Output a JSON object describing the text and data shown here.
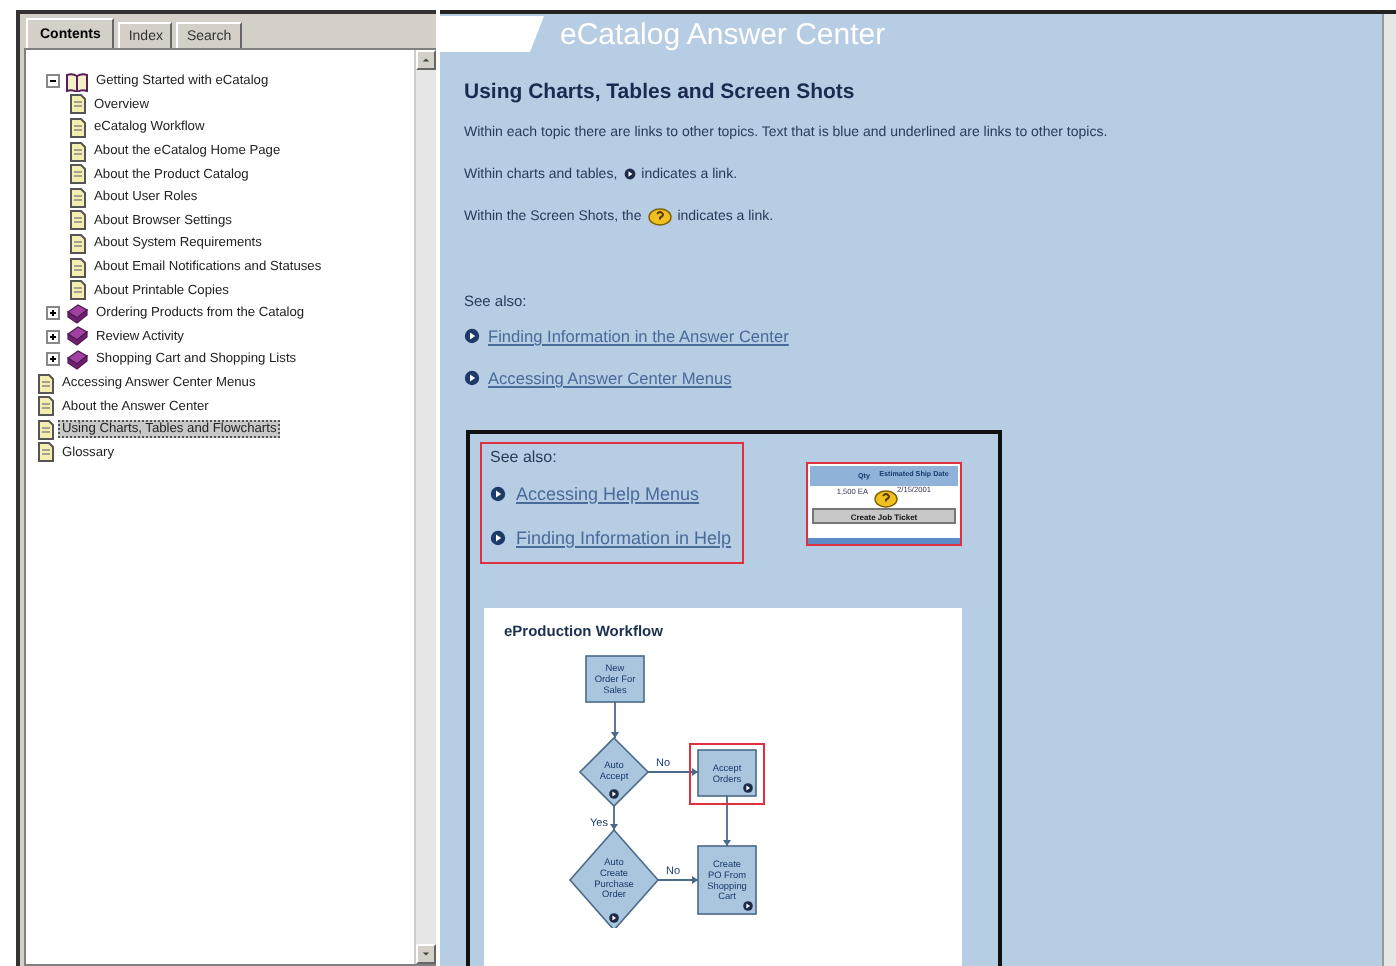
{
  "tabs": [
    {
      "label": "Contents",
      "selected": true
    },
    {
      "label": "Index",
      "selected": false
    },
    {
      "label": "Search",
      "selected": false
    }
  ],
  "tree": [
    {
      "label": "Getting Started with eCatalog",
      "kind": "book",
      "expanded": true,
      "selected": false,
      "children": [
        {
          "label": "Overview",
          "kind": "page",
          "selected": false
        },
        {
          "label": "eCatalog Workflow",
          "kind": "page",
          "selected": false
        },
        {
          "label": "About the eCatalog Home Page",
          "kind": "page",
          "selected": false
        },
        {
          "label": "About the Product Catalog",
          "kind": "page",
          "selected": false
        },
        {
          "label": "About User Roles",
          "kind": "page",
          "selected": false
        },
        {
          "label": "About Browser Settings",
          "kind": "page",
          "selected": false
        },
        {
          "label": "About System Requirements",
          "kind": "page",
          "selected": false
        },
        {
          "label": "About Email Notifications and Statuses",
          "kind": "page",
          "selected": false
        },
        {
          "label": "About Printable Copies",
          "kind": "page",
          "selected": false
        }
      ]
    },
    {
      "label": "Ordering Products from the Catalog",
      "kind": "book",
      "expanded": false,
      "selected": false
    },
    {
      "label": "Review Activity",
      "kind": "book",
      "expanded": false,
      "selected": false
    },
    {
      "label": "Shopping Cart and Shopping Lists",
      "kind": "book",
      "expanded": false,
      "selected": false
    },
    {
      "label": "Accessing Answer Center Menus",
      "kind": "page",
      "selected": false
    },
    {
      "label": "About the Answer Center",
      "kind": "page",
      "selected": false
    },
    {
      "label": "Using Charts, Tables and Flowcharts",
      "kind": "page",
      "selected": true
    },
    {
      "label": "Glossary",
      "kind": "page",
      "selected": false
    }
  ],
  "header": {
    "title": "eCatalog Answer Center"
  },
  "topic": {
    "heading": "Using Charts, Tables and Screen Shots",
    "paragraphs": [
      {
        "parts": [
          {
            "kind": "text",
            "text": "Within each topic there are links to other topics. Text that is blue and underlined are links to other topics."
          }
        ]
      },
      {
        "parts": [
          {
            "kind": "text",
            "text": "Within charts and tables,"
          },
          {
            "kind": "link_marker"
          },
          {
            "kind": "text",
            "text": "indicates a link."
          }
        ]
      },
      {
        "parts": [
          {
            "kind": "text",
            "text": "Within the Screen Shots, the"
          },
          {
            "kind": "help_marker"
          },
          {
            "kind": "text",
            "text": "indicates a link."
          }
        ]
      }
    ],
    "see_also": {
      "label": "See also:",
      "links": [
        "Finding Information in the Answer Center",
        "Accessing Answer Center Menus"
      ]
    }
  },
  "example": {
    "see_also": {
      "label": "See also:",
      "highlighted": true,
      "links": [
        "Accessing Help Menus",
        "Finding Information in Help"
      ]
    },
    "screenshot": {
      "highlighted": true,
      "columns": [
        "Qty",
        "Estimated Ship Date"
      ],
      "row": [
        "1,500 EA",
        "2/15/2001"
      ],
      "button": "Create Job Ticket"
    },
    "workflow": {
      "title": "eProduction Workflow",
      "nodes": [
        {
          "kind": "process",
          "lines": [
            "New",
            "Order For",
            "Sales"
          ],
          "link": false,
          "highlighted": false
        },
        {
          "kind": "decision",
          "lines": [
            "Auto",
            "Accept"
          ],
          "link": true,
          "highlighted": false
        },
        {
          "kind": "process",
          "lines": [
            "Accept",
            "Orders"
          ],
          "link": true,
          "highlighted": true
        },
        {
          "kind": "decision",
          "lines": [
            "Auto",
            "Create",
            "Purchase",
            "Order"
          ],
          "link": true,
          "highlighted": false
        },
        {
          "kind": "process",
          "lines": [
            "Create",
            "PO From",
            "Shopping",
            "Cart"
          ],
          "link": true,
          "highlighted": false
        }
      ],
      "edge_labels": [
        "No",
        "Yes",
        "No"
      ]
    }
  }
}
